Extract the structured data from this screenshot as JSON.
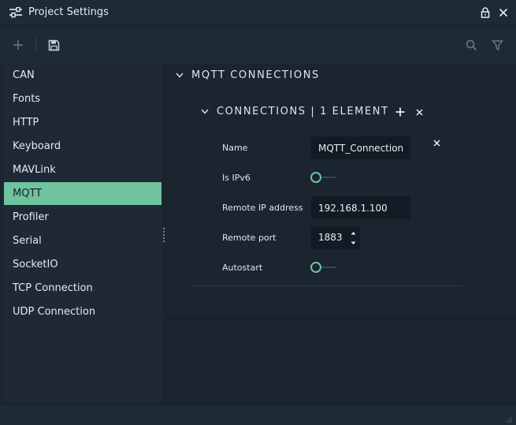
{
  "window": {
    "title": "Project Settings"
  },
  "sidebar": {
    "items": [
      {
        "label": "CAN",
        "active": false
      },
      {
        "label": "Fonts",
        "active": false
      },
      {
        "label": "HTTP",
        "active": false
      },
      {
        "label": "Keyboard",
        "active": false
      },
      {
        "label": "MAVLink",
        "active": false
      },
      {
        "label": "MQTT",
        "active": true
      },
      {
        "label": "Profiler",
        "active": false
      },
      {
        "label": "Serial",
        "active": false
      },
      {
        "label": "SocketIO",
        "active": false
      },
      {
        "label": "TCP Connection",
        "active": false
      },
      {
        "label": "UDP Connection",
        "active": false
      }
    ]
  },
  "main": {
    "section_title": "MQTT CONNECTIONS",
    "subsection_title": "CONNECTIONS | 1 ELEMENT",
    "fields": {
      "name": {
        "label": "Name",
        "value": "MQTT_Connection"
      },
      "ipv6": {
        "label": "Is IPv6",
        "checked": false
      },
      "remote_ip": {
        "label": "Remote IP address",
        "value": "192.168.1.100"
      },
      "remote_port": {
        "label": "Remote port",
        "value": "1883"
      },
      "autostart": {
        "label": "Autostart",
        "checked": false
      }
    }
  },
  "colors": {
    "accent": "#6fc39e",
    "background": "#1a2530",
    "panel": "#1e2935",
    "input": "#121b24"
  },
  "icons": {
    "app": "sliders-icon",
    "lock": "lock-icon",
    "close": "close-icon",
    "add": "plus-icon",
    "save": "save-icon",
    "search": "search-icon",
    "filter": "filter-icon"
  }
}
